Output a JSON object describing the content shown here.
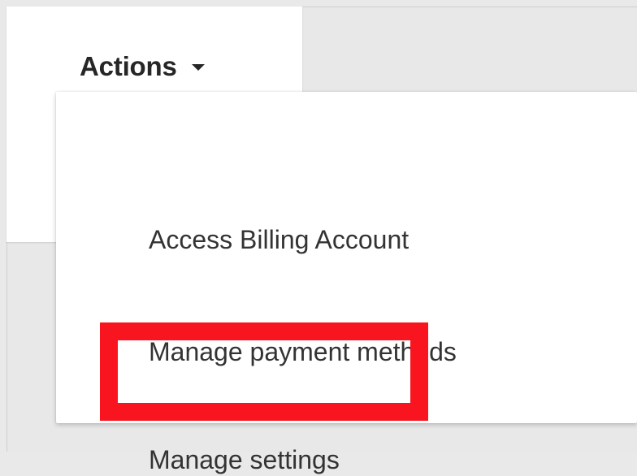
{
  "actions_button": {
    "label": "Actions",
    "icon": "caret-down-icon"
  },
  "menu": {
    "items": [
      {
        "label": "Access Billing Account"
      },
      {
        "label": "Manage payment methods"
      },
      {
        "label": "Manage settings"
      }
    ],
    "highlighted_item": "Manage settings",
    "highlight_color": "#f81520"
  },
  "colors": {
    "background": "#e8e8e8",
    "panel": "#ffffff",
    "text": "#333333"
  }
}
